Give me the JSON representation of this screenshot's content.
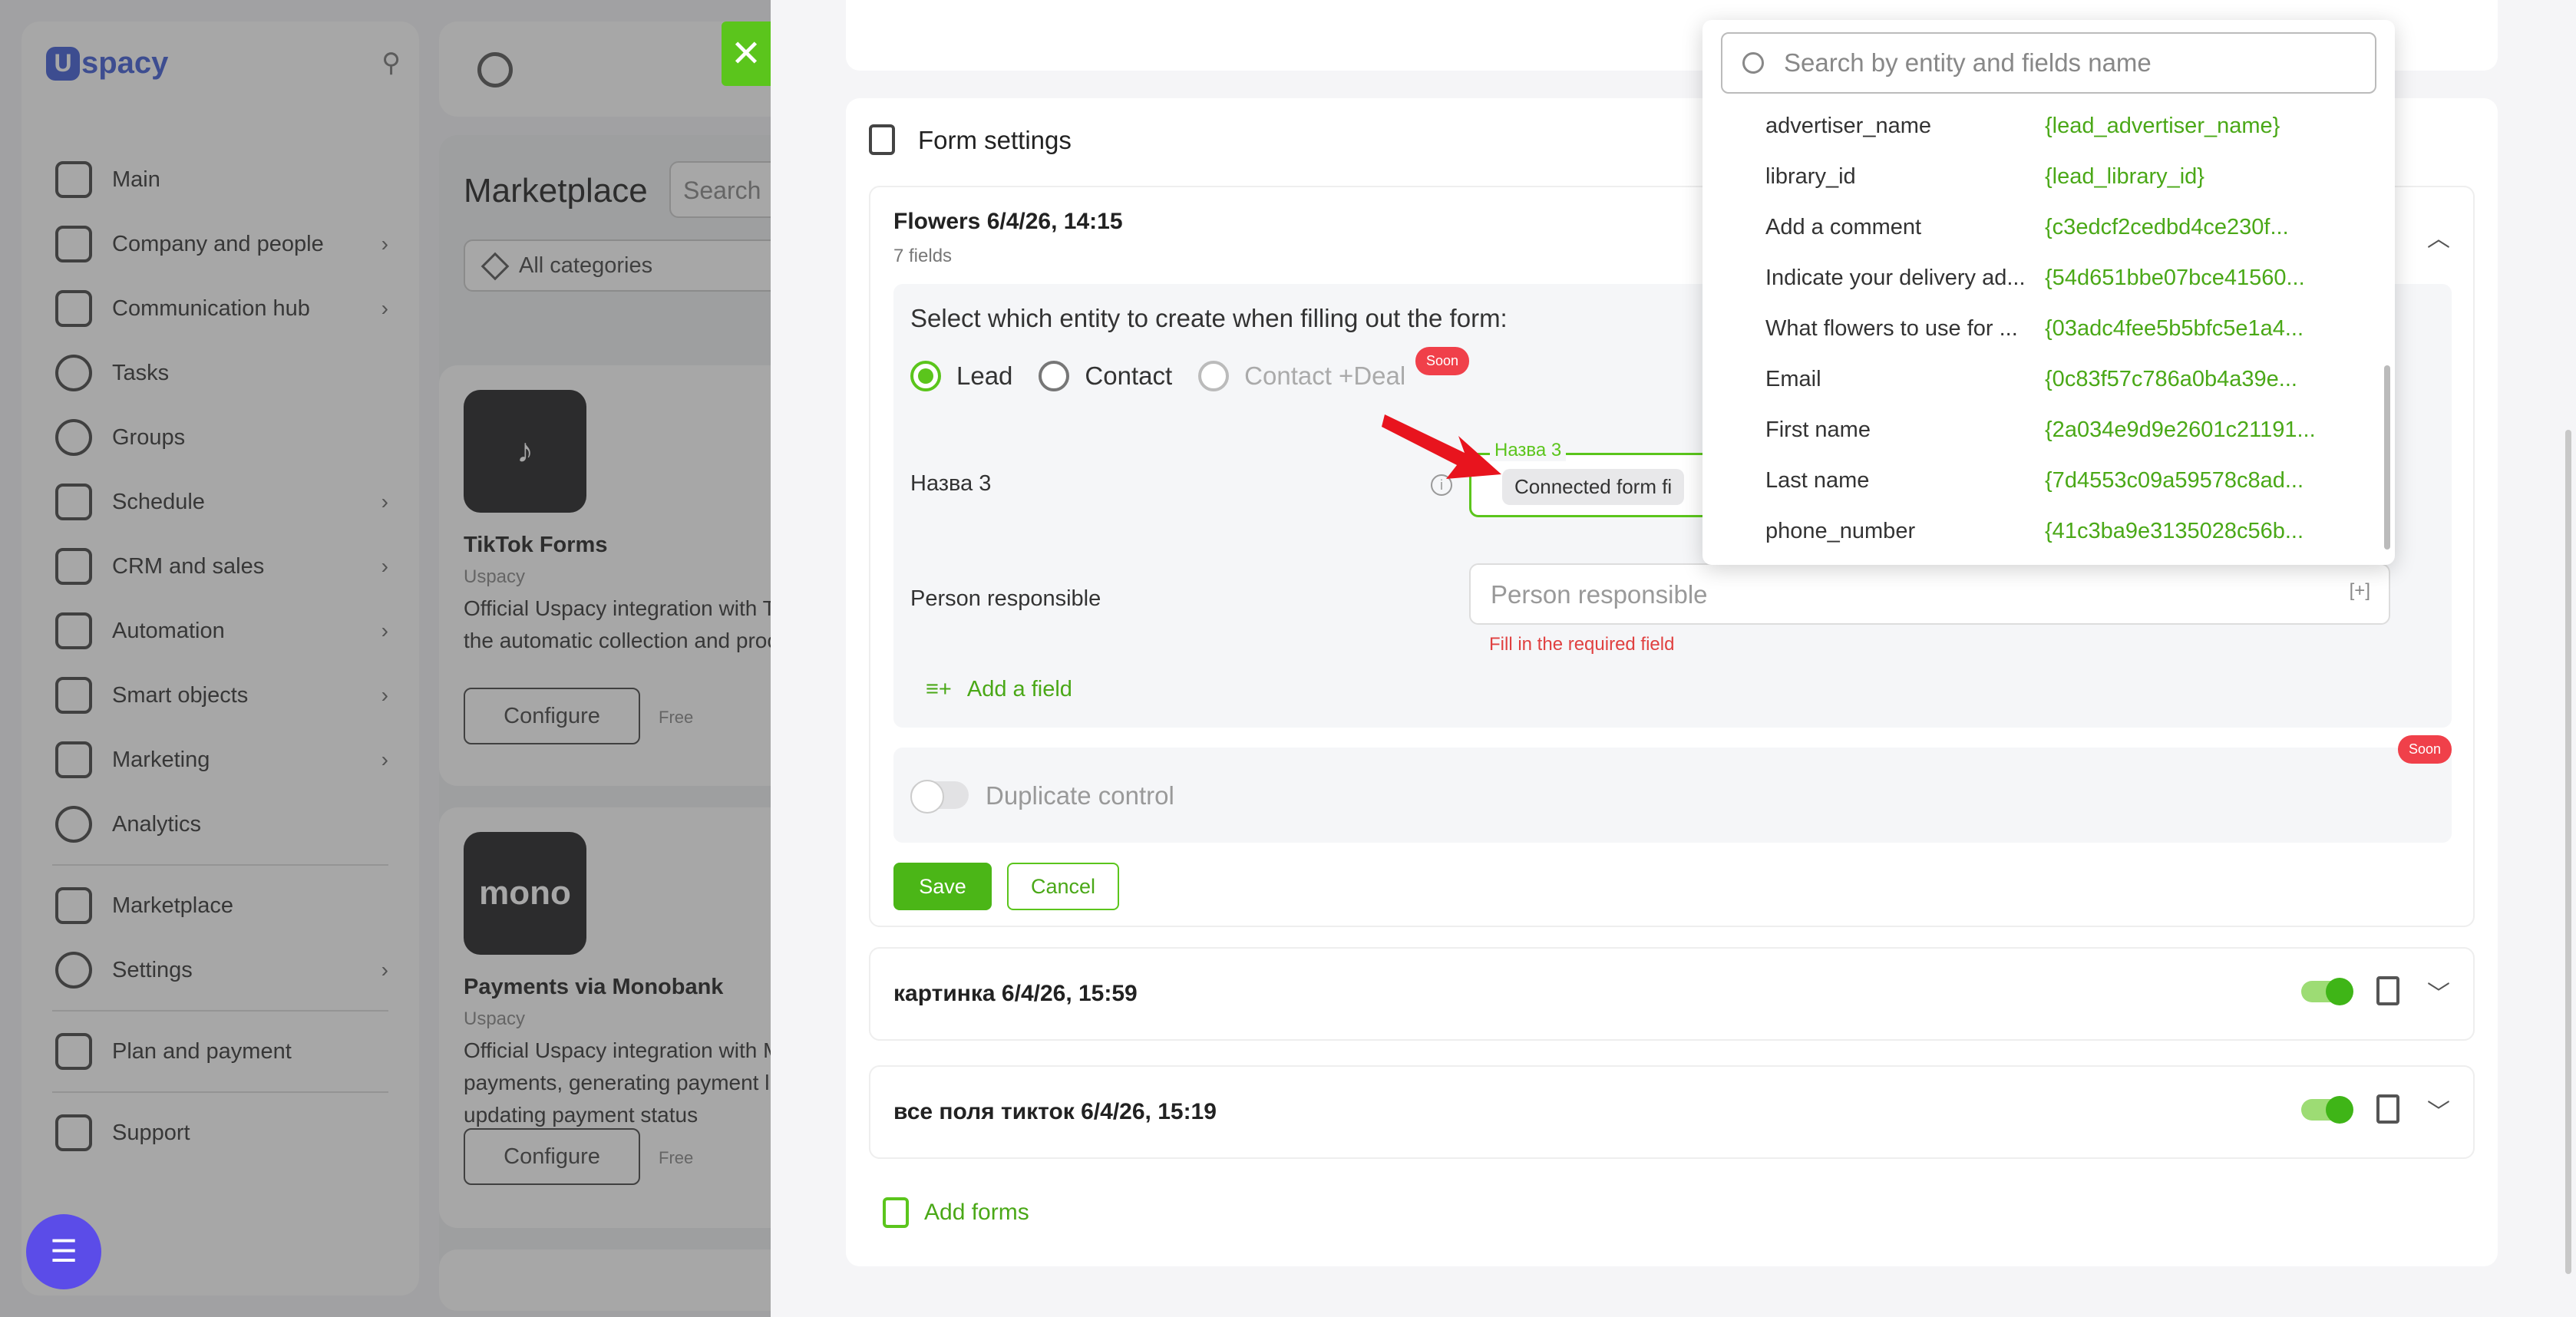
{
  "sidebar": {
    "logo_letter": "U",
    "logo_text": "spacy",
    "items": [
      {
        "label": "Main",
        "chevron": ""
      },
      {
        "label": "Company and people",
        "chevron": "›"
      },
      {
        "label": "Communication hub",
        "chevron": "›"
      },
      {
        "label": "Tasks",
        "chevron": ""
      },
      {
        "label": "Groups",
        "chevron": ""
      },
      {
        "label": "Schedule",
        "chevron": "›"
      },
      {
        "label": "CRM and sales",
        "chevron": "›"
      },
      {
        "label": "Automation",
        "chevron": "›"
      },
      {
        "label": "Smart objects",
        "chevron": "›"
      },
      {
        "label": "Marketing",
        "chevron": "›"
      },
      {
        "label": "Analytics",
        "chevron": ""
      },
      {
        "label": "Marketplace",
        "chevron": ""
      },
      {
        "label": "Settings",
        "chevron": "›"
      },
      {
        "label": "Plan and payment",
        "chevron": ""
      },
      {
        "label": "Support",
        "chevron": ""
      }
    ]
  },
  "marketplace": {
    "title": "Marketplace",
    "search_placeholder": "Search",
    "category": "All categories",
    "cards": [
      {
        "icon_text": "♪",
        "title": "TikTok Forms",
        "vendor": "Uspacy",
        "desc1": "Official Uspacy integration with TikTok Forms for",
        "desc2": "the automatic collection and processing",
        "desc3": "",
        "button": "Configure",
        "price": "Free"
      },
      {
        "icon_text": "mono",
        "title": "Payments via Monobank",
        "vendor": "Uspacy",
        "desc1": "Official Uspacy integration with Monobank for",
        "desc2": "payments, generating payment links and",
        "desc3": "updating payment status",
        "button": "Configure",
        "price": "Free"
      }
    ]
  },
  "form_settings": {
    "title": "Form settings",
    "form1": {
      "name": "Flowers 6/4/26, 14:15",
      "fields_count": "7 fields",
      "entity_question": "Select which entity to create when filling out the form:",
      "radio_lead": "Lead",
      "radio_contact": "Contact",
      "radio_contact_deal": "Contact +Deal",
      "soon": "Soon",
      "field_name_label": "Назва 3",
      "field_name_legend": "Назва 3",
      "field_name_chip": "Connected form fi",
      "person_label": "Person responsible",
      "person_placeholder": "Person responsible",
      "person_plus": "[+]",
      "person_error": "Fill in the required field",
      "add_field": "Add a field",
      "duplicate_control": "Duplicate control",
      "duplicate_soon": "Soon",
      "save": "Save",
      "cancel": "Cancel"
    },
    "form2_name": "картинка 6/4/26, 15:59",
    "form3_name": "все поля тикток 6/4/26, 15:19",
    "add_forms": "Add forms"
  },
  "dropdown": {
    "search_placeholder": "Search by entity and fields name",
    "items": [
      {
        "name": "advertiser_name",
        "key": "{lead_advertiser_name}"
      },
      {
        "name": "library_id",
        "key": "{lead_library_id}"
      },
      {
        "name": "Add a comment",
        "key": "{c3edcf2cedbd4ce230f..."
      },
      {
        "name": "Indicate your delivery ad...",
        "key": "{54d651bbe07bce41560..."
      },
      {
        "name": "What flowers to use for ...",
        "key": "{03adc4fee5b5bfc5e1a4..."
      },
      {
        "name": "Email",
        "key": "{0c83f57c786a0b4a39e..."
      },
      {
        "name": "First name",
        "key": "{2a034e9d9e2601c21191..."
      },
      {
        "name": "Last name",
        "key": "{7d4553c09a59578c8ad..."
      },
      {
        "name": "phone_number",
        "key": "{41c3ba9e3135028c56b..."
      }
    ]
  },
  "colors": {
    "accent": "#5bc51c",
    "error": "#e04040",
    "soon_badge": "#f0404a",
    "brand": "#3f5bd6",
    "chat": "#5b4ce8"
  },
  "icons": {
    "close": "close-icon",
    "search": "search-icon",
    "pin": "pin-icon",
    "chat": "chat-icon",
    "trash": "trash-icon",
    "chevron": "chevron-down-icon"
  }
}
